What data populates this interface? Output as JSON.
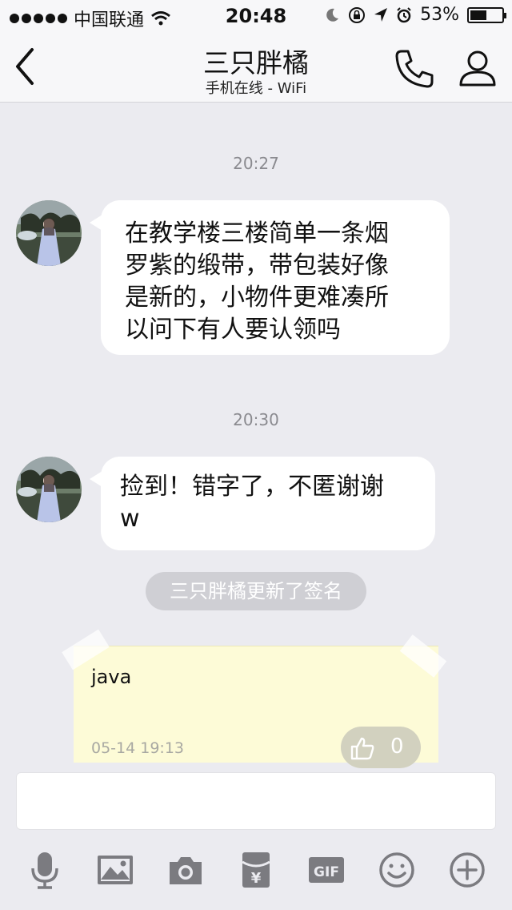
{
  "status_bar": {
    "carrier": "中国联通",
    "time": "20:48",
    "battery_percent": "53%",
    "battery_level": 0.53
  },
  "nav": {
    "title": "三只胖橘",
    "subtitle": "手机在线 - WiFi"
  },
  "messages": [
    {
      "timestamp": "20:27",
      "lines": [
        "在教学楼三楼简单一条烟",
        "罗紫的缎带，带包装好像",
        "是新的，小物件更难凑所",
        "以问下有人要认领吗"
      ]
    },
    {
      "timestamp": "20:30",
      "lines": [
        "捡到！错字了，不匿谢谢",
        "w"
      ]
    }
  ],
  "system_notice": "三只胖橘更新了签名",
  "signature_card": {
    "text": "java",
    "date": "05-14 19:13",
    "likes": "0"
  },
  "toolbar": [
    "mic-icon",
    "image-icon",
    "camera-icon",
    "red-packet-icon",
    "gif-icon",
    "emoji-icon",
    "plus-icon"
  ],
  "colors": {
    "background": "#ebebf0",
    "bubble": "#ffffff",
    "note": "#fdfbd7",
    "icon": "#7b7b80"
  }
}
